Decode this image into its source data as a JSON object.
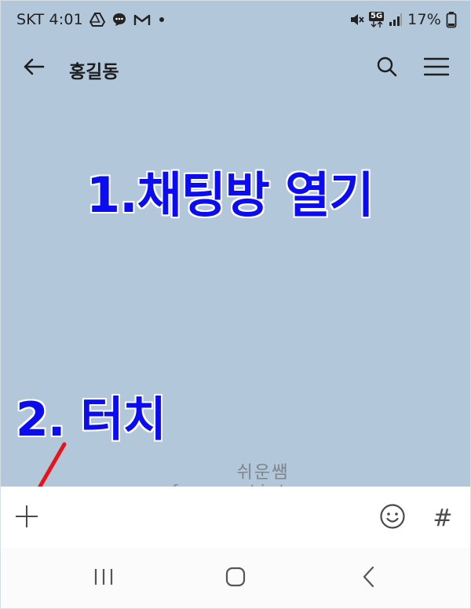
{
  "status_bar": {
    "carrier_time": "SKT 4:01",
    "battery": "17%",
    "network": "5G",
    "icons": [
      "drive-icon",
      "chat-bubble-icon",
      "gmail-icon",
      "dot-icon",
      "mute-icon",
      "signal-icon",
      "battery-icon"
    ]
  },
  "header": {
    "title": "홍길동",
    "icons": [
      "back-arrow-icon",
      "search-icon",
      "menu-icon"
    ]
  },
  "annotations": {
    "step1": "1.채팅방 열기",
    "step2": "2. 터치",
    "arrow_color": "#e8141c",
    "text_color": "#0b0cf0"
  },
  "watermark": {
    "name": "쉬운쌤",
    "url": "fervors.tistory.com"
  },
  "input_bar": {
    "hash": "#",
    "icons": [
      "plus-icon",
      "emoji-icon",
      "hash-icon"
    ]
  },
  "nav_bar": {
    "icons": [
      "recent-apps-icon",
      "home-icon",
      "back-icon"
    ]
  },
  "colors": {
    "chat_background": "#b2c7da",
    "input_background": "#ffffff",
    "nav_background": "#fbfbfb"
  }
}
